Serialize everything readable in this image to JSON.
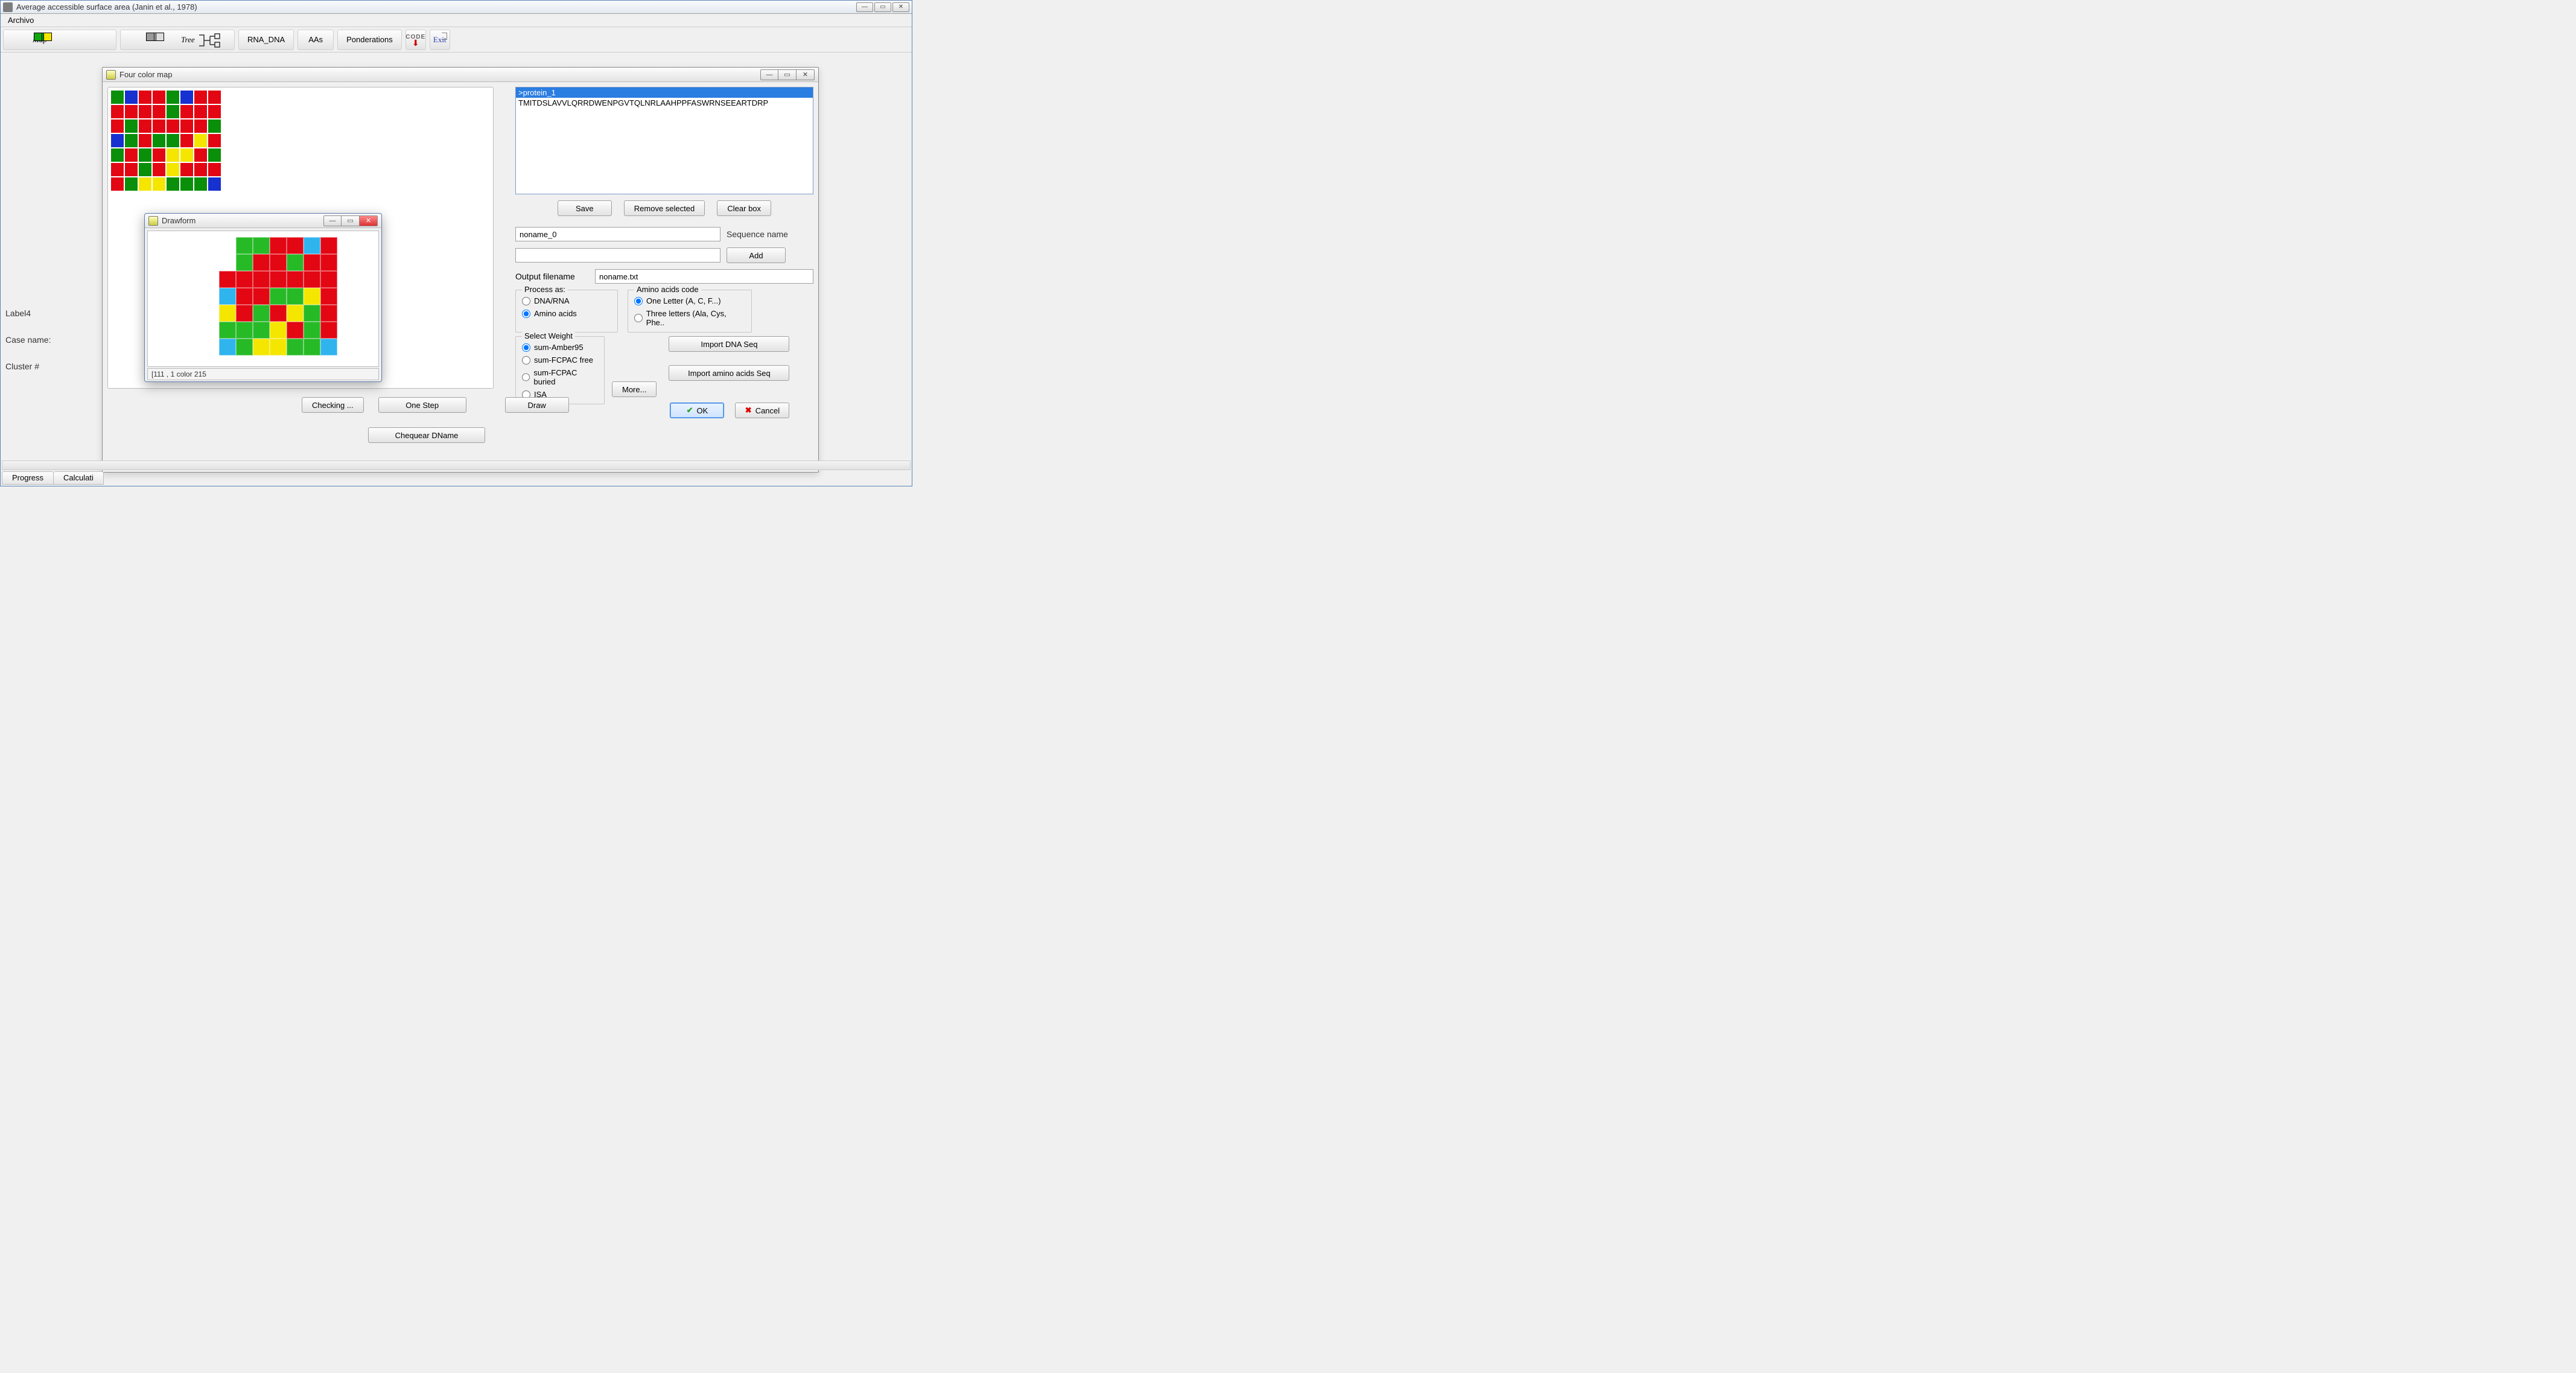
{
  "window": {
    "title": "Average accessible surface area (Janin et al., 1978)",
    "faded_suffix": ""
  },
  "menu": {
    "file": "Archivo"
  },
  "toolbar": {
    "map_label": "Map",
    "tree_label": "Tree",
    "rna_dna": "RNA_DNA",
    "aas": "AAs",
    "ponderations": "Ponderations",
    "code": "CODE",
    "exit": "Exit"
  },
  "left_labels": {
    "label4": "Label4",
    "case_name": "Case name:",
    "cluster": "Cluster #"
  },
  "fcm": {
    "title": "Four color map",
    "buttons": {
      "checking": "Checking ...",
      "one_step": "One Step",
      "draw": "Draw",
      "chequear": "Chequear DName"
    },
    "grid": [
      [
        1,
        2,
        0,
        0,
        1,
        2,
        0,
        0
      ],
      [
        0,
        0,
        0,
        0,
        1,
        0,
        0,
        0
      ],
      [
        0,
        1,
        0,
        0,
        0,
        0,
        0,
        1
      ],
      [
        2,
        1,
        0,
        1,
        1,
        0,
        3,
        0
      ],
      [
        1,
        0,
        1,
        0,
        3,
        3,
        0,
        1
      ],
      [
        0,
        0,
        1,
        0,
        3,
        0,
        0,
        0
      ],
      [
        0,
        1,
        3,
        3,
        1,
        1,
        1,
        2
      ]
    ]
  },
  "drawform": {
    "title": "Drawform",
    "status": "[111 , 1 color 215",
    "grid": [
      [
        -1,
        1,
        1,
        0,
        0,
        2,
        0
      ],
      [
        -1,
        1,
        0,
        0,
        1,
        0,
        0
      ],
      [
        0,
        0,
        0,
        0,
        0,
        0,
        0
      ],
      [
        2,
        0,
        0,
        1,
        1,
        3,
        0
      ],
      [
        3,
        0,
        1,
        0,
        3,
        1,
        0
      ],
      [
        1,
        1,
        1,
        3,
        0,
        1,
        0
      ],
      [
        2,
        1,
        3,
        3,
        1,
        1,
        2
      ]
    ]
  },
  "right": {
    "seq_header": ">protein_1",
    "seq_body": "TMITDSLAVVLQRRDWENPGVTQLNRLAAHPPFASWRNSEEARTDRP",
    "btns": {
      "save": "Save",
      "remove": "Remove selected",
      "clear": "Clear box"
    },
    "name_value": "noname_0",
    "name_label": "Sequence name",
    "add_value": "",
    "add_label": "Add",
    "output_label": "Output filename",
    "output_value": "noname.txt",
    "process_as": {
      "legend": "Process as:",
      "dna": "DNA/RNA",
      "aa": "Amino acids"
    },
    "aacode": {
      "legend": "Amino acids code",
      "one": "One Letter (A, C, F...)",
      "three": "Three letters (Ala, Cys, Phe.."
    },
    "select_weight": {
      "legend": "Select Weight",
      "opts": [
        "sum-Amber95",
        "sum-FCPAC free",
        "sum-FCPAC buried",
        "ISA"
      ]
    },
    "more": "More...",
    "import_dna": "Import DNA Seq",
    "import_aa": "Import amino acids Seq",
    "ok": "OK",
    "cancel": "Cancel"
  },
  "status_tabs": {
    "progress": "Progress",
    "calc": "Calculati"
  }
}
